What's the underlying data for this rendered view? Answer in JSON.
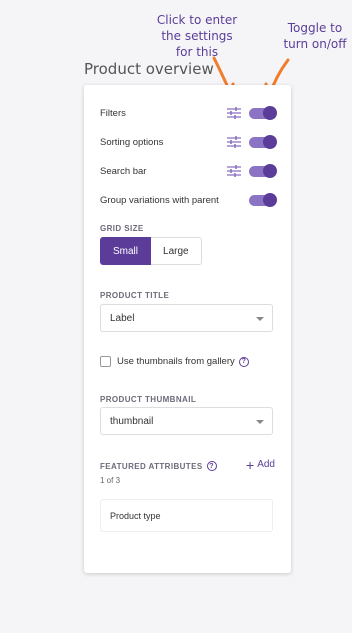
{
  "annotations": {
    "settings_hint": "Click to enter\nthe settings\nfor this",
    "toggle_hint": "Toggle to\nturn on/off",
    "color": "#f07c2c"
  },
  "panel": {
    "title": "Product overview",
    "rows": [
      {
        "label": "Filters",
        "has_settings": true,
        "enabled": true
      },
      {
        "label": "Sorting options",
        "has_settings": true,
        "enabled": true
      },
      {
        "label": "Search bar",
        "has_settings": true,
        "enabled": true
      },
      {
        "label": "Group variations with parent",
        "has_settings": false,
        "enabled": true
      }
    ],
    "grid_size": {
      "heading": "GRID SIZE",
      "options": [
        "Small",
        "Large"
      ],
      "selected": "Small"
    },
    "product_title": {
      "heading": "PRODUCT TITLE",
      "value": "Label"
    },
    "thumbnails_checkbox": {
      "label": "Use thumbnails from gallery",
      "checked": false
    },
    "product_thumbnail": {
      "heading": "PRODUCT THUMBNAIL",
      "value": "thumbnail"
    },
    "featured_attributes": {
      "heading": "FEATURED ATTRIBUTES",
      "add_label": "Add",
      "count": "1 of 3",
      "items": [
        "Product type"
      ]
    }
  },
  "colors": {
    "accent": "#5b3d99",
    "toggle_track": "#8b74c4",
    "arrow": "#f07c2c"
  }
}
